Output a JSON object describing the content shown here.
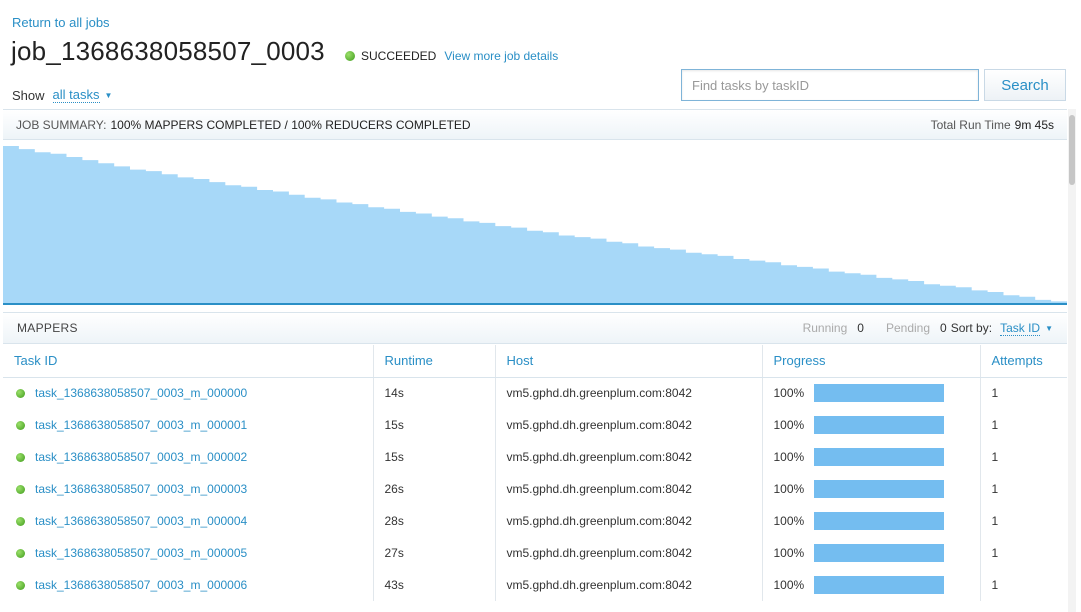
{
  "header": {
    "return_link": "Return to all jobs",
    "job_id": "job_1368638058507_0003",
    "status": "SUCCEEDED",
    "details_link": "View more job details"
  },
  "filter": {
    "show_label": "Show",
    "show_value": "all tasks"
  },
  "search": {
    "placeholder": "Find tasks by taskID",
    "button": "Search"
  },
  "summary": {
    "label": "JOB SUMMARY:",
    "text": "100% MAPPERS COMPLETED / 100% REDUCERS COMPLETED",
    "runtime_label": "Total Run Time",
    "runtime_value": "9m 45s"
  },
  "colors": {
    "accent": "#2a8fc6",
    "chart_fill": "#a7d8f8",
    "chart_line": "#2a8fc6",
    "progress": "#74bdf0",
    "success": "#4caf26"
  },
  "chart_data": {
    "type": "area",
    "title": "",
    "xlabel": "",
    "ylabel": "",
    "ylim": [
      0,
      1
    ],
    "values": [
      1.0,
      0.98,
      0.96,
      0.95,
      0.93,
      0.91,
      0.89,
      0.87,
      0.85,
      0.84,
      0.82,
      0.8,
      0.79,
      0.77,
      0.75,
      0.74,
      0.72,
      0.71,
      0.69,
      0.67,
      0.66,
      0.64,
      0.63,
      0.61,
      0.6,
      0.58,
      0.57,
      0.55,
      0.54,
      0.52,
      0.51,
      0.49,
      0.48,
      0.46,
      0.45,
      0.43,
      0.42,
      0.41,
      0.39,
      0.38,
      0.36,
      0.35,
      0.34,
      0.32,
      0.31,
      0.3,
      0.28,
      0.27,
      0.26,
      0.24,
      0.23,
      0.22,
      0.2,
      0.19,
      0.18,
      0.16,
      0.15,
      0.14,
      0.12,
      0.11,
      0.1,
      0.08,
      0.07,
      0.05,
      0.04,
      0.02,
      0.01
    ]
  },
  "mappers": {
    "title": "MAPPERS",
    "running_label": "Running",
    "running_value": "0",
    "pending_label": "Pending",
    "pending_value": "0",
    "sort_label": "Sort by:",
    "sort_value": "Task ID"
  },
  "table": {
    "columns": [
      "Task ID",
      "Runtime",
      "Host",
      "Progress",
      "Attempts"
    ],
    "rows": [
      {
        "task": "task_1368638058507_0003_m_000000",
        "runtime": "14s",
        "host": "vm5.gphd.dh.greenplum.com:8042",
        "progress": "100%",
        "progress_value": 1.0,
        "attempts": "1"
      },
      {
        "task": "task_1368638058507_0003_m_000001",
        "runtime": "15s",
        "host": "vm5.gphd.dh.greenplum.com:8042",
        "progress": "100%",
        "progress_value": 1.0,
        "attempts": "1"
      },
      {
        "task": "task_1368638058507_0003_m_000002",
        "runtime": "15s",
        "host": "vm5.gphd.dh.greenplum.com:8042",
        "progress": "100%",
        "progress_value": 1.0,
        "attempts": "1"
      },
      {
        "task": "task_1368638058507_0003_m_000003",
        "runtime": "26s",
        "host": "vm5.gphd.dh.greenplum.com:8042",
        "progress": "100%",
        "progress_value": 1.0,
        "attempts": "1"
      },
      {
        "task": "task_1368638058507_0003_m_000004",
        "runtime": "28s",
        "host": "vm5.gphd.dh.greenplum.com:8042",
        "progress": "100%",
        "progress_value": 1.0,
        "attempts": "1"
      },
      {
        "task": "task_1368638058507_0003_m_000005",
        "runtime": "27s",
        "host": "vm5.gphd.dh.greenplum.com:8042",
        "progress": "100%",
        "progress_value": 1.0,
        "attempts": "1"
      },
      {
        "task": "task_1368638058507_0003_m_000006",
        "runtime": "43s",
        "host": "vm5.gphd.dh.greenplum.com:8042",
        "progress": "100%",
        "progress_value": 1.0,
        "attempts": "1"
      }
    ]
  }
}
